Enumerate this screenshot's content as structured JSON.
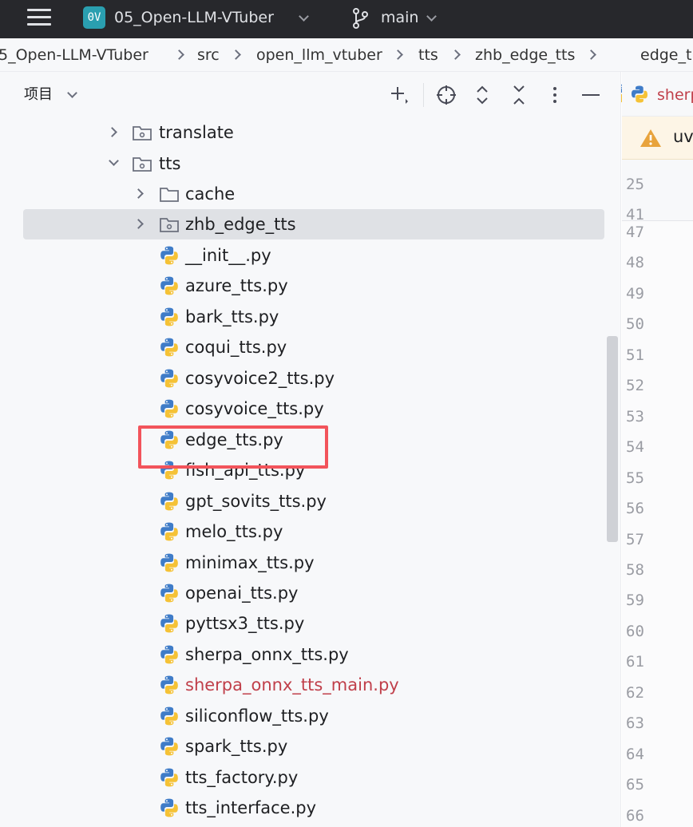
{
  "topbar": {
    "project_badge": "0V",
    "project_name": "05_Open-LLM-VTuber",
    "branch": "main",
    "colors": {
      "background": "#27282c",
      "badge": "#2a9fb0"
    }
  },
  "breadcrumb": [
    "5_Open-LLM-VTuber",
    "src",
    "open_llm_vtuber",
    "tts",
    "zhb_edge_tts",
    "edge_t"
  ],
  "panel": {
    "title": "项目"
  },
  "tree": [
    {
      "label": "translate",
      "type": "package"
    },
    {
      "label": "tts",
      "type": "package"
    },
    {
      "label": "cache",
      "type": "folder"
    },
    {
      "label": "zhb_edge_tts",
      "type": "package"
    },
    {
      "label": "__init__.py",
      "type": "python"
    },
    {
      "label": "azure_tts.py",
      "type": "python"
    },
    {
      "label": "bark_tts.py",
      "type": "python"
    },
    {
      "label": "coqui_tts.py",
      "type": "python"
    },
    {
      "label": "cosyvoice2_tts.py",
      "type": "python"
    },
    {
      "label": "cosyvoice_tts.py",
      "type": "python"
    },
    {
      "label": "edge_tts.py",
      "type": "python"
    },
    {
      "label": "fish_api_tts.py",
      "type": "python"
    },
    {
      "label": "gpt_sovits_tts.py",
      "type": "python"
    },
    {
      "label": "melo_tts.py",
      "type": "python"
    },
    {
      "label": "minimax_tts.py",
      "type": "python"
    },
    {
      "label": "openai_tts.py",
      "type": "python"
    },
    {
      "label": "pyttsx3_tts.py",
      "type": "python"
    },
    {
      "label": "sherpa_onnx_tts.py",
      "type": "python"
    },
    {
      "label": "sherpa_onnx_tts_main.py",
      "type": "python",
      "modified": true
    },
    {
      "label": "siliconflow_tts.py",
      "type": "python"
    },
    {
      "label": "spark_tts.py",
      "type": "python"
    },
    {
      "label": "tts_factory.py",
      "type": "python"
    },
    {
      "label": "tts_interface.py",
      "type": "python"
    }
  ],
  "selected_item": "zhb_edge_tts",
  "highlighted_item": "edge_tts.py",
  "editor": {
    "tab_label": "sherp",
    "warning_text": "uv",
    "sticky_lines": [
      "25",
      "41"
    ],
    "line_numbers": [
      "47",
      "48",
      "49",
      "50",
      "51",
      "52",
      "53",
      "54",
      "55",
      "56",
      "57",
      "58",
      "59",
      "60",
      "61",
      "62",
      "63",
      "64",
      "65",
      "66"
    ]
  },
  "colors": {
    "modified_file": "#c03f4a",
    "highlight_box": "#f2545b",
    "selection": "#dfe1e5"
  }
}
